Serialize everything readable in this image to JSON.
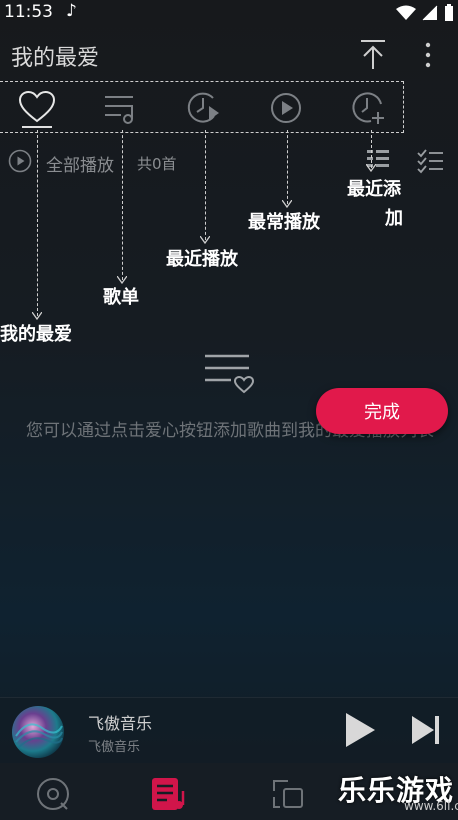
{
  "status_bar": {
    "time": "11:53",
    "note_glyph": "♪"
  },
  "app_bar": {
    "title": "我的最爱",
    "upload_icon": "upload-top-icon",
    "more_icon": "more-vertical-icon"
  },
  "tabs": [
    {
      "icon": "heart-icon",
      "annotation": "我的最爱",
      "selected": true
    },
    {
      "icon": "playlist-icon",
      "annotation": "歌单",
      "selected": false
    },
    {
      "icon": "recent-play-icon",
      "annotation": "最近播放",
      "selected": false
    },
    {
      "icon": "play-circle-icon",
      "annotation": "最常播放",
      "selected": false
    },
    {
      "icon": "recent-add-icon",
      "annotation_line1": "最近添",
      "annotation_line2": "加",
      "selected": false
    }
  ],
  "list_header": {
    "play_all": "全部播放",
    "count": "共0首"
  },
  "empty_state": {
    "message": "您可以通过点击爱心按钮添加歌曲到我的最爱播放列表"
  },
  "done_button": {
    "label": "完成"
  },
  "colors": {
    "accent": "#e1194b",
    "background": "#161c22",
    "text_muted": "#8a8d91"
  },
  "player": {
    "title": "飞傲音乐",
    "artist": "飞傲音乐"
  },
  "nav": [
    {
      "icon": "disc-icon",
      "active": false
    },
    {
      "icon": "music-list-icon",
      "active": true
    },
    {
      "icon": "switch-icon",
      "active": false
    }
  ],
  "watermark": {
    "text": "乐乐游戏",
    "url": "www.6ll.com"
  }
}
